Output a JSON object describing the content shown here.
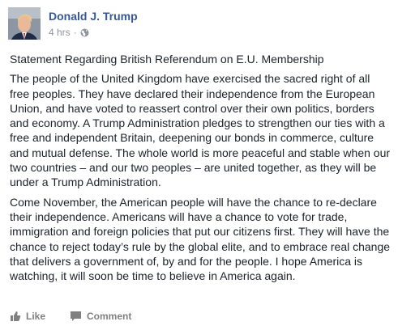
{
  "post": {
    "author": "Donald J. Trump",
    "timestamp": "4 hrs",
    "separator": "·",
    "privacy_icon": "globe-icon",
    "heading": "Statement Regarding British Referendum on E.U. Membership",
    "paragraphs": [
      "The people of the United Kingdom have exercised the sacred right of all free peoples. They have declared their independence from the European Union, and have voted to reassert control over their own politics, borders and economy. A Trump Administration pledges to strengthen our ties with a free and independent Britain, deepening our bonds in commerce, culture and mutual defense. The whole world is more peaceful and stable when our two countries – and our two peoples – are united together, as they will be under a Trump Administration.",
      "Come November, the American people will have the chance to re-declare their independence. Americans will have a chance to vote for trade, immigration and foreign policies that put our citizens first. They will have the chance to reject today’s rule by the global elite, and to embrace real change that delivers a government of, by and for the people. I hope America is watching, it will soon be time to believe in America again."
    ]
  },
  "actions": {
    "like_label": "Like",
    "like_icon": "thumbs-up-icon",
    "comment_label": "Comment",
    "comment_icon": "comment-icon"
  },
  "colors": {
    "author_link": "#365899",
    "meta_text": "#90949c",
    "body_text": "#1d2129",
    "action_text": "#7f7f7f"
  }
}
